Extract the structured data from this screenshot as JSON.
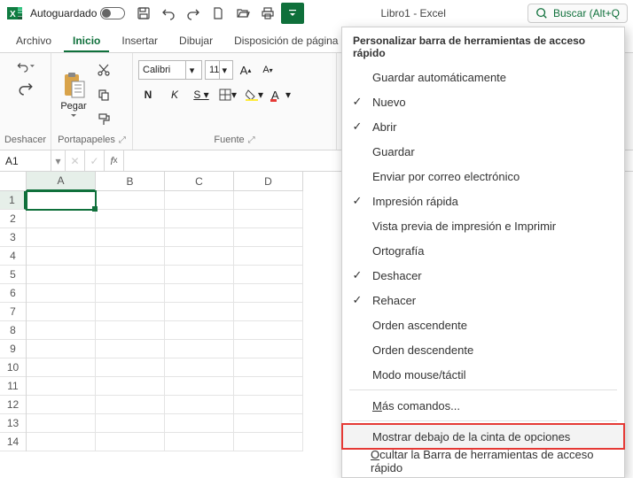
{
  "titlebar": {
    "autosave_label": "Autoguardado",
    "title": "Libro1 - Excel",
    "search_placeholder": "Buscar (Alt+Q"
  },
  "tabs": [
    "Archivo",
    "Inicio",
    "Insertar",
    "Dibujar",
    "Disposición de página"
  ],
  "active_tab_index": 1,
  "ribbon": {
    "undo_group": "Deshacer",
    "clipboard_group": "Portapapeles",
    "paste_label": "Pegar",
    "font_group": "Fuente",
    "font_name": "Calibri",
    "font_size": "11"
  },
  "namebox": "A1",
  "columns": [
    "A",
    "B",
    "C",
    "D"
  ],
  "rows": [
    "1",
    "2",
    "3",
    "4",
    "5",
    "6",
    "7",
    "8",
    "9",
    "10",
    "11",
    "12",
    "13",
    "14"
  ],
  "active_cell": {
    "col": 0,
    "row": 0
  },
  "menu": {
    "title": "Personalizar barra de herramientas de acceso rápido",
    "items": [
      {
        "label": "Guardar automáticamente",
        "checked": false
      },
      {
        "label": "Nuevo",
        "checked": true
      },
      {
        "label": "Abrir",
        "checked": true
      },
      {
        "label": "Guardar",
        "checked": false
      },
      {
        "label": "Enviar por correo electrónico",
        "checked": false
      },
      {
        "label": "Impresión rápida",
        "checked": true
      },
      {
        "label": "Vista previa de impresión e Imprimir",
        "checked": false
      },
      {
        "label": "Ortografía",
        "checked": false
      },
      {
        "label": "Deshacer",
        "checked": true
      },
      {
        "label": "Rehacer",
        "checked": true
      },
      {
        "label": "Orden ascendente",
        "checked": false
      },
      {
        "label": "Orden descendente",
        "checked": false
      },
      {
        "label": "Modo mouse/táctil",
        "checked": false
      }
    ],
    "more_label_pre": "M",
    "more_label_post": "ás comandos...",
    "show_below_label": "Mostrar debajo de la cinta de opciones",
    "hide_qat_label_pre": "O",
    "hide_qat_label_post": "cultar la Barra de herramientas de acceso rápido"
  }
}
